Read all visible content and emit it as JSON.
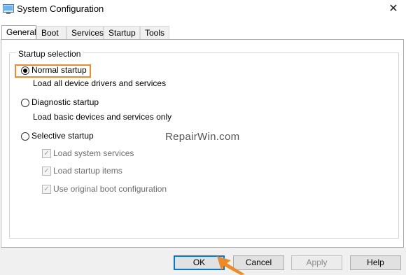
{
  "window": {
    "title": "System Configuration",
    "close_glyph": "✕"
  },
  "tabs": [
    {
      "label": "General",
      "active": true
    },
    {
      "label": "Boot",
      "active": false
    },
    {
      "label": "Services",
      "active": false
    },
    {
      "label": "Startup",
      "active": false
    },
    {
      "label": "Tools",
      "active": false
    }
  ],
  "startup_selection": {
    "group_label": "Startup selection",
    "normal": {
      "label": "Normal startup",
      "description": "Load all device drivers and services",
      "selected": true
    },
    "diagnostic": {
      "label": "Diagnostic startup",
      "description": "Load basic devices and services only",
      "selected": false
    },
    "selective": {
      "label": "Selective startup",
      "selected": false,
      "options": [
        {
          "label": "Load system services",
          "checked": true,
          "enabled": false
        },
        {
          "label": "Load startup items",
          "checked": true,
          "enabled": false
        },
        {
          "label": "Use original boot configuration",
          "checked": true,
          "enabled": false
        }
      ]
    }
  },
  "watermark": "RepairWin.com",
  "buttons": {
    "ok": "OK",
    "cancel": "Cancel",
    "apply": "Apply",
    "help": "Help"
  },
  "colors": {
    "highlight": "#ef8a2b",
    "default_button_border": "#0078d7",
    "arrow": "#f08a24"
  },
  "icons": {
    "app": "system-configuration-icon",
    "close": "close-icon",
    "arrow": "pointer-arrow-icon"
  }
}
